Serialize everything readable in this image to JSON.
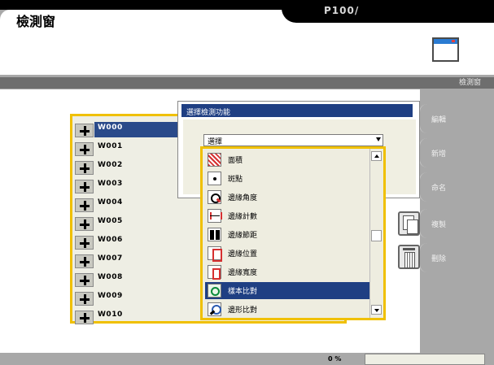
{
  "header": {
    "app_title": "檢測窗",
    "model_label": "P100/"
  },
  "band": {
    "label": "檢測窗"
  },
  "side_buttons": {
    "edit": "編輯",
    "new": "新增",
    "rename": "命名",
    "copy": "複製",
    "delete": "刪除"
  },
  "windows": [
    "W000",
    "W001",
    "W002",
    "W003",
    "W004",
    "W005",
    "W006",
    "W007",
    "W008",
    "W009",
    "W010"
  ],
  "selected_window": "W000",
  "dialog": {
    "title": "選擇檢測功能",
    "select_value": "選擇",
    "options": [
      {
        "label": "面積",
        "icon": "area-icon"
      },
      {
        "label": "斑點",
        "icon": "spot-icon"
      },
      {
        "label": "邊緣角度",
        "icon": "edge-angle-icon"
      },
      {
        "label": "邊緣計數",
        "icon": "edge-count-icon"
      },
      {
        "label": "邊緣節距",
        "icon": "edge-pitch-icon"
      },
      {
        "label": "邊緣位置",
        "icon": "edge-position-icon"
      },
      {
        "label": "邊緣寬度",
        "icon": "edge-width-icon"
      },
      {
        "label": "樣本比對",
        "icon": "pattern-match-icon"
      },
      {
        "label": "邊形比對",
        "icon": "shape-match-icon"
      }
    ],
    "selected_option": "樣本比對"
  },
  "status": {
    "progress_text": "0 %"
  },
  "colors": {
    "accent_yellow": "#f0c000",
    "selection_blue": "#1f3f83",
    "panel_gray": "#a8a8a8"
  }
}
